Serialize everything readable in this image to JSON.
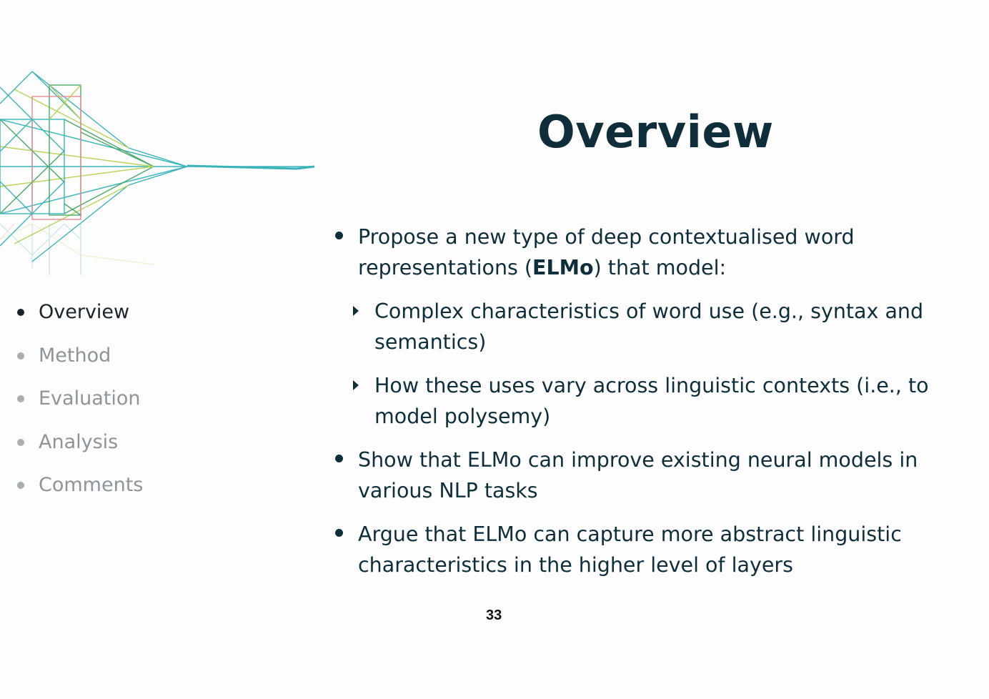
{
  "title": "Overview",
  "colors": {
    "title": "#0f2e3a",
    "body_text": "#0f2e3a",
    "nav_active": "#1a2329",
    "nav_inactive": "#8e9498",
    "decor_teal": "#3bb3b8",
    "decor_green": "#4aa86a",
    "decor_lime": "#b6d35a",
    "decor_pink": "#e38b93"
  },
  "nav": {
    "items": [
      {
        "label": "Overview",
        "active": true
      },
      {
        "label": "Method",
        "active": false
      },
      {
        "label": "Evaluation",
        "active": false
      },
      {
        "label": "Analysis",
        "active": false
      },
      {
        "label": "Comments",
        "active": false
      }
    ]
  },
  "content": {
    "b1": {
      "pre": "Propose a new type of deep contextualised word representations (",
      "bold": "ELMo",
      "post": ") that model:"
    },
    "sub1": "Complex characteristics of word use (e.g., syntax and semantics)",
    "sub2": "How these uses vary across linguistic contexts (i.e., to model polysemy)",
    "b2": "Show that ELMo can improve existing neural models in various NLP tasks",
    "b3": "Argue that ELMo can capture more abstract linguistic characteristics in the higher level of layers"
  },
  "page_number": "33",
  "decor_icon": "network-lines-graphic"
}
